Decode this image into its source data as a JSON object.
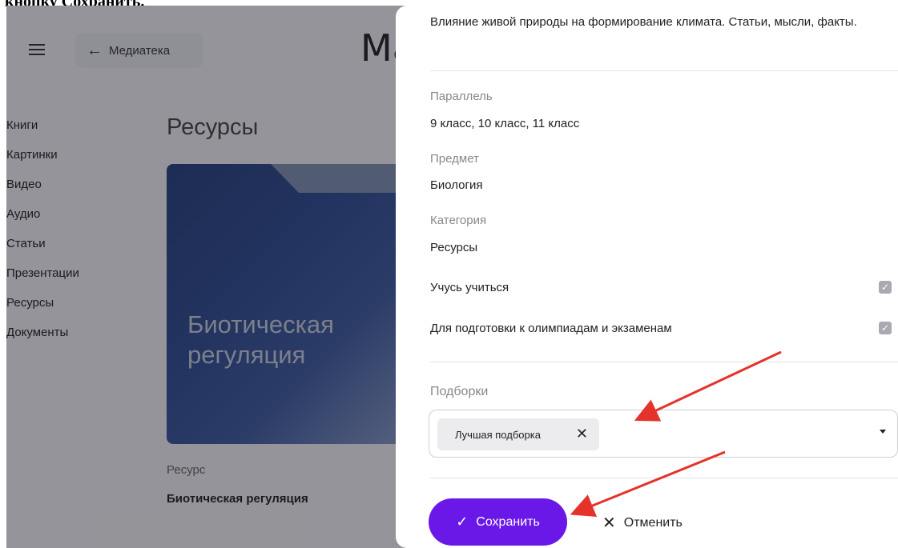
{
  "caption": {
    "text": "кнопку Сохранить."
  },
  "app": {
    "back_label": "Медиатека",
    "title": "Ма",
    "nav": [
      "Книги",
      "Картинки",
      "Видео",
      "Аудио",
      "Статьи",
      "Презентации",
      "Ресурсы",
      "Документы"
    ],
    "section_heading": "Ресурсы",
    "card_title_line1": "Биотическая",
    "card_title_line2": "регуляция",
    "resource_kind": "Ресурс",
    "resource_name": "Биотическая регуляция"
  },
  "panel": {
    "description": "Влияние живой природы на формирование климата. Статьи, мысли, факты.",
    "fields": [
      {
        "label": "Параллель",
        "value": "9 класс, 10 класс, 11 класс"
      },
      {
        "label": "Предмет",
        "value": "Биология"
      },
      {
        "label": "Категория",
        "value": "Ресурсы"
      }
    ],
    "checks": [
      {
        "label": "Учусь учиться",
        "checked": true
      },
      {
        "label": "Для подготовки к олимпиадам и экзаменам",
        "checked": true
      }
    ],
    "collections_label": "Подборки",
    "selected_chip": "Лучшая подборка",
    "save_label": "Сохранить",
    "cancel_label": "Отменить"
  },
  "colors": {
    "accent": "#6a18e8",
    "arrow": "#e5322b",
    "overlay": "#14141c"
  }
}
